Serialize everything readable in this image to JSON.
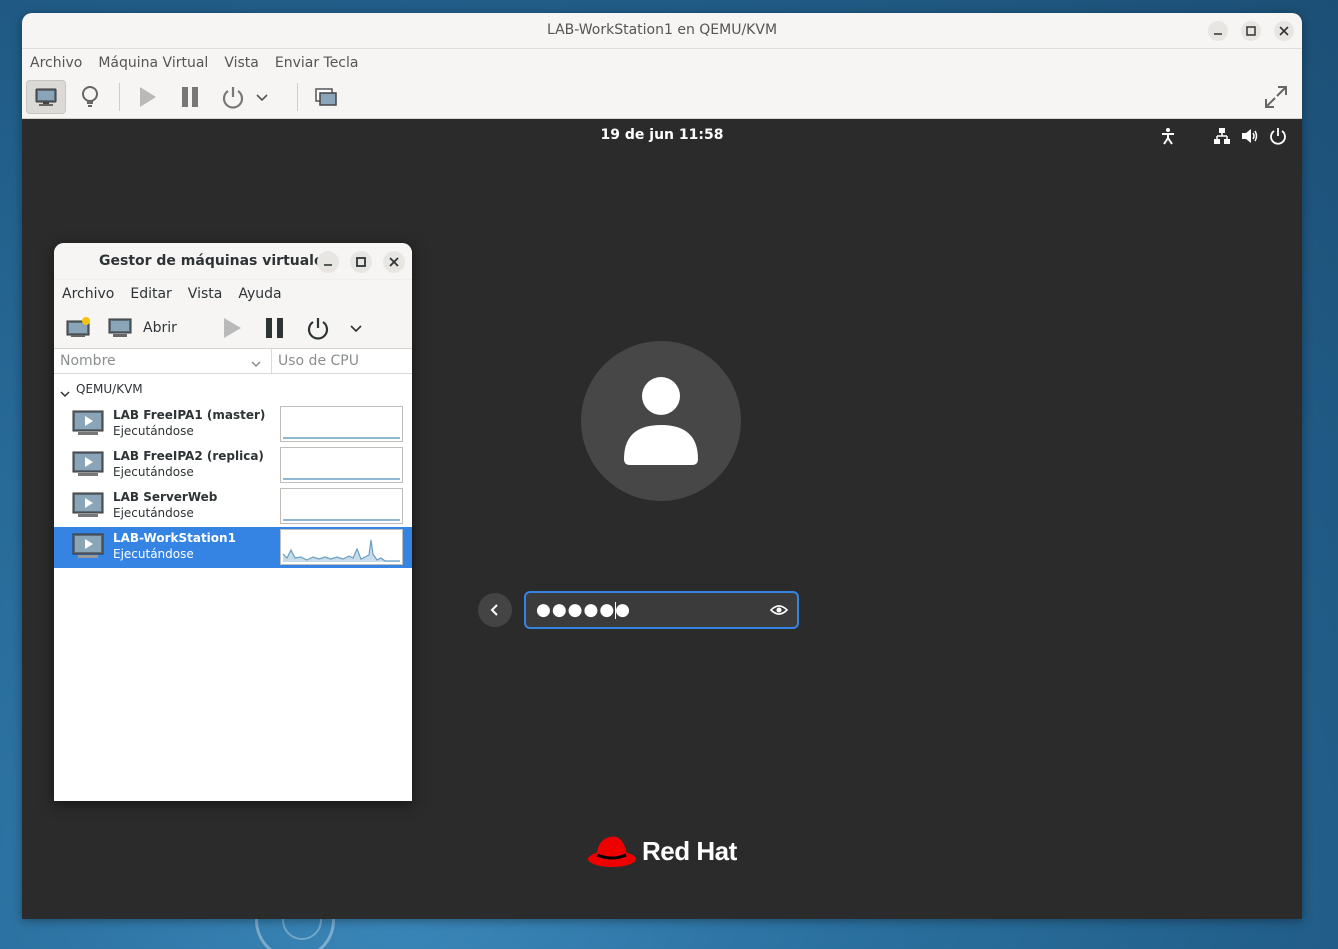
{
  "viewer": {
    "title": "LAB-WorkStation1 en QEMU/KVM",
    "menu": [
      "Archivo",
      "Máquina Virtual",
      "Vista",
      "Enviar Tecla"
    ],
    "toolbar_icons": [
      "monitor-icon",
      "lightbulb-icon",
      "play-icon",
      "pause-icon",
      "power-icon",
      "chevron-down-icon",
      "screenshot-icon",
      "fullscreen-icon"
    ]
  },
  "guest": {
    "clock": "19 de jun  11:58",
    "status_icons": [
      "accessibility-icon",
      "network-icon",
      "volume-icon",
      "power-icon"
    ],
    "password_mask": "●●●●●●",
    "brand": "Red Hat"
  },
  "vmm": {
    "title": "Gestor de máquinas virtuales",
    "menu": [
      "Archivo",
      "Editar",
      "Vista",
      "Ayuda"
    ],
    "open_label": "Abrir",
    "columns": {
      "name": "Nombre",
      "cpu": "Uso de CPU"
    },
    "group": "QEMU/KVM",
    "vms": [
      {
        "name": "LAB FreeIPA1 (master)",
        "status": "Ejecutándose",
        "selected": false
      },
      {
        "name": "LAB FreeIPA2 (replica)",
        "status": "Ejecutándose",
        "selected": false
      },
      {
        "name": "LAB ServerWeb",
        "status": "Ejecutándose",
        "selected": false
      },
      {
        "name": "LAB-WorkStation1",
        "status": "Ejecutándose",
        "selected": true
      }
    ]
  },
  "colors": {
    "accent": "#3584e4",
    "guest_bg": "#2b2b2b",
    "redhat": "#ee0000"
  }
}
